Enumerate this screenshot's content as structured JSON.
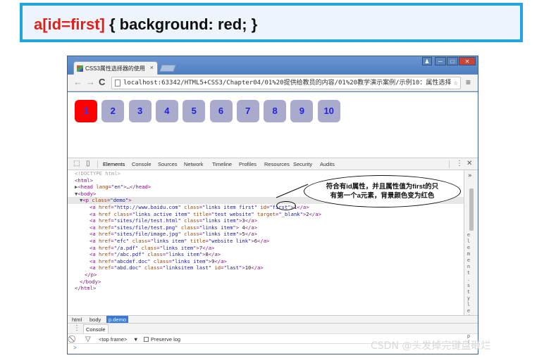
{
  "banner": {
    "selector": "a[id=first]",
    "declaration": " { background: red; }"
  },
  "browser": {
    "tab_title": "CSS3属性选择器的使用",
    "tab_close": "×",
    "window_buttons": {
      "user": "♟",
      "minimize": "─",
      "maximize": "□",
      "close": "✕"
    },
    "nav": {
      "back": "←",
      "forward": "→",
      "reload": "C"
    },
    "url": "localhost:63342/HTML5+CSS3/Chapter04/01%20提供给教员的内容/01%20教学演示案例/示例10：属性选择",
    "bookmark_star": "☆",
    "menu": "≡"
  },
  "page": {
    "links": [
      {
        "label": "1",
        "bg": "#ff0000",
        "color": "#3333ff"
      },
      {
        "label": "2",
        "bg": "#aaaacc",
        "color": "#2222dd"
      },
      {
        "label": "3",
        "bg": "#aaaacc",
        "color": "#2222dd"
      },
      {
        "label": "4",
        "bg": "#aaaacc",
        "color": "#2222dd"
      },
      {
        "label": "5",
        "bg": "#aaaacc",
        "color": "#2222dd"
      },
      {
        "label": "6",
        "bg": "#aaaacc",
        "color": "#2222dd"
      },
      {
        "label": "7",
        "bg": "#aaaacc",
        "color": "#2222dd"
      },
      {
        "label": "8",
        "bg": "#aaaacc",
        "color": "#2222dd"
      },
      {
        "label": "9",
        "bg": "#aaaacc",
        "color": "#2222dd"
      },
      {
        "label": "10",
        "bg": "#aaaacc",
        "color": "#2222dd"
      }
    ]
  },
  "devtools": {
    "inspect_icon": "⬚",
    "device_icon": "▯",
    "tabs": [
      "Elements",
      "Console",
      "Sources",
      "Network",
      "Timeline",
      "Profiles",
      "Resources",
      "Security",
      "Audits"
    ],
    "active_tab": "Elements",
    "more_icon": "⋮",
    "close_icon": "✕",
    "side_toggle": "»",
    "side_text": "element.style{}:p{",
    "breadcrumb": [
      "html",
      "body",
      "p.demo"
    ],
    "drawer_more": "⋮",
    "drawer_tab": "Console",
    "console_toolbar": {
      "clear_icon": "⃠",
      "filter_icon": "▽",
      "frame": "<top frame>",
      "frame_arrow": "▼",
      "preserve_log": "Preserve log"
    },
    "prompt": ">"
  },
  "dom_tree": [
    {
      "indent": 0,
      "parts": [
        [
          "cm",
          "<!DOCTYPE html>"
        ]
      ]
    },
    {
      "indent": 0,
      "parts": [
        [
          "tg",
          "<html>"
        ]
      ]
    },
    {
      "indent": 0,
      "parts": [
        [
          "ar",
          "▶"
        ],
        [
          "tg",
          "<head "
        ],
        [
          "at",
          "lang"
        ],
        [
          "tg",
          "="
        ],
        [
          "av",
          "\"en\""
        ],
        [
          "tg",
          ">"
        ],
        [
          "tx",
          "…"
        ],
        [
          "tg",
          "</head>"
        ]
      ]
    },
    {
      "indent": 0,
      "parts": [
        [
          "ar",
          "▼"
        ],
        [
          "tg",
          "<body>"
        ]
      ]
    },
    {
      "indent": 1,
      "hl": true,
      "parts": [
        [
          "ar",
          "▼"
        ],
        [
          "tg",
          "<p "
        ],
        [
          "at",
          "class"
        ],
        [
          "tg",
          "="
        ],
        [
          "av",
          "\"demo\""
        ],
        [
          "tg",
          ">"
        ]
      ]
    },
    {
      "indent": 3,
      "parts": [
        [
          "tg",
          "<a "
        ],
        [
          "at",
          "href"
        ],
        [
          "tg",
          "="
        ],
        [
          "av",
          "\"http://www.baidu.com\""
        ],
        [
          "at",
          " class"
        ],
        [
          "tg",
          "="
        ],
        [
          "av",
          "\"links item first\""
        ],
        [
          "at",
          " id"
        ],
        [
          "tg",
          "="
        ],
        [
          "av",
          "\"first\""
        ],
        [
          "tg",
          ">"
        ],
        [
          "tx",
          "1"
        ],
        [
          "tg",
          "</a>"
        ]
      ]
    },
    {
      "indent": 3,
      "parts": [
        [
          "tg",
          "<a "
        ],
        [
          "at",
          "href"
        ],
        [
          "at",
          " class"
        ],
        [
          "tg",
          "="
        ],
        [
          "av",
          "\"links active item\""
        ],
        [
          "at",
          " title"
        ],
        [
          "tg",
          "="
        ],
        [
          "av",
          "\"test website\""
        ],
        [
          "at",
          " target"
        ],
        [
          "tg",
          "="
        ],
        [
          "av",
          "\"_blank\""
        ],
        [
          "tg",
          ">"
        ],
        [
          "tx",
          "2"
        ],
        [
          "tg",
          "</a>"
        ]
      ]
    },
    {
      "indent": 3,
      "parts": [
        [
          "tg",
          "<a "
        ],
        [
          "at",
          "href"
        ],
        [
          "tg",
          "="
        ],
        [
          "av",
          "\"sites/file/test.html\""
        ],
        [
          "at",
          " class"
        ],
        [
          "tg",
          "="
        ],
        [
          "av",
          "\"links item\""
        ],
        [
          "tg",
          ">"
        ],
        [
          "tx",
          "3"
        ],
        [
          "tg",
          "</a>"
        ]
      ]
    },
    {
      "indent": 3,
      "parts": [
        [
          "tg",
          "<a "
        ],
        [
          "at",
          "href"
        ],
        [
          "tg",
          "="
        ],
        [
          "av",
          "\"sites/file/test.png\""
        ],
        [
          "at",
          " class"
        ],
        [
          "tg",
          "="
        ],
        [
          "av",
          "\"links item\""
        ],
        [
          "tg",
          ">"
        ],
        [
          "tx",
          " 4"
        ],
        [
          "tg",
          "</a>"
        ]
      ]
    },
    {
      "indent": 3,
      "parts": [
        [
          "tg",
          "<a "
        ],
        [
          "at",
          "href"
        ],
        [
          "tg",
          "="
        ],
        [
          "av",
          "\"sites/file/image.jpg\""
        ],
        [
          "at",
          " class"
        ],
        [
          "tg",
          "="
        ],
        [
          "av",
          "\"links item\""
        ],
        [
          "tg",
          ">"
        ],
        [
          "tx",
          "5"
        ],
        [
          "tg",
          "</a>"
        ]
      ]
    },
    {
      "indent": 3,
      "parts": [
        [
          "tg",
          "<a "
        ],
        [
          "at",
          "href"
        ],
        [
          "tg",
          "="
        ],
        [
          "av",
          "\"efc\""
        ],
        [
          "at",
          " class"
        ],
        [
          "tg",
          "="
        ],
        [
          "av",
          "\"links item\""
        ],
        [
          "at",
          " title"
        ],
        [
          "tg",
          "="
        ],
        [
          "av",
          "\"website link\""
        ],
        [
          "tg",
          ">"
        ],
        [
          "tx",
          "6"
        ],
        [
          "tg",
          "</a>"
        ]
      ]
    },
    {
      "indent": 3,
      "parts": [
        [
          "tg",
          "<a "
        ],
        [
          "at",
          "href"
        ],
        [
          "tg",
          "="
        ],
        [
          "av",
          "\"/a.pdf\""
        ],
        [
          "at",
          " class"
        ],
        [
          "tg",
          "="
        ],
        [
          "av",
          "\"links item\""
        ],
        [
          "tg",
          ">"
        ],
        [
          "tx",
          "7"
        ],
        [
          "tg",
          "</a>"
        ]
      ]
    },
    {
      "indent": 3,
      "parts": [
        [
          "tg",
          "<a "
        ],
        [
          "at",
          "href"
        ],
        [
          "tg",
          "="
        ],
        [
          "av",
          "\"/abc.pdf\""
        ],
        [
          "at",
          " class"
        ],
        [
          "tg",
          "="
        ],
        [
          "av",
          "\"links item\""
        ],
        [
          "tg",
          ">"
        ],
        [
          "tx",
          "8"
        ],
        [
          "tg",
          "</a>"
        ]
      ]
    },
    {
      "indent": 3,
      "parts": [
        [
          "tg",
          "<a "
        ],
        [
          "at",
          "href"
        ],
        [
          "tg",
          "="
        ],
        [
          "av",
          "\"abcdef.doc\""
        ],
        [
          "at",
          " class"
        ],
        [
          "tg",
          "="
        ],
        [
          "av",
          "\"links item\""
        ],
        [
          "tg",
          ">"
        ],
        [
          "tx",
          "9"
        ],
        [
          "tg",
          "</a>"
        ]
      ]
    },
    {
      "indent": 3,
      "parts": [
        [
          "tg",
          "<a "
        ],
        [
          "at",
          "href"
        ],
        [
          "tg",
          "="
        ],
        [
          "av",
          "\"abd.doc\""
        ],
        [
          "at",
          " class"
        ],
        [
          "tg",
          "="
        ],
        [
          "av",
          "\"linksitem last\""
        ],
        [
          "at",
          " id"
        ],
        [
          "tg",
          "="
        ],
        [
          "av",
          "\"last\""
        ],
        [
          "tg",
          ">"
        ],
        [
          "tx",
          "10"
        ],
        [
          "tg",
          "</a>"
        ]
      ]
    },
    {
      "indent": 2,
      "parts": [
        [
          "tg",
          "</p>"
        ]
      ]
    },
    {
      "indent": 1,
      "parts": [
        [
          "tg",
          "</body>"
        ]
      ]
    },
    {
      "indent": 0,
      "parts": [
        [
          "tg",
          "</html>"
        ]
      ]
    }
  ],
  "callout": {
    "line1": "符合有id属性，并且属性值为first的只",
    "line2": "有第一个a元素，背景颜色变为红色"
  },
  "watermark": "CSDN @头发掉完键盘砸烂"
}
